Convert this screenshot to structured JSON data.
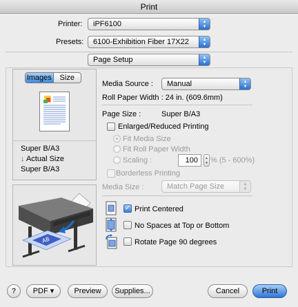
{
  "window": {
    "title": "Print"
  },
  "printer": {
    "label": "Printer:",
    "value": "iPF6100"
  },
  "presets": {
    "label": "Presets:",
    "value": "6100-Exhibition Fiber 17X22"
  },
  "section": {
    "value": "Page Setup"
  },
  "left_panel": {
    "tabs": [
      {
        "label": "Images"
      },
      {
        "label": "Size"
      }
    ],
    "size_text": [
      "Super B/A3",
      "Actual Size",
      "Super B/A3"
    ]
  },
  "media_source": {
    "label": "Media Source :",
    "value": "Manual"
  },
  "roll_paper_width": {
    "text": "Roll Paper Width : 24 in. (609.6mm)"
  },
  "page_size": {
    "label": "Page Size :",
    "value": "Super B/A3"
  },
  "enlarged": {
    "label": "Enlarged/Reduced Printing"
  },
  "fit_media": {
    "label": "Fit Media Size"
  },
  "fit_roll": {
    "label": "Fit Roll Paper Width"
  },
  "scaling": {
    "label": "Scaling :",
    "value": "100",
    "suffix": "% (5 - 600%)"
  },
  "borderless": {
    "label": "Borderless Printing"
  },
  "media_size": {
    "label": "Media Size :",
    "value": "Match Page Size"
  },
  "print_centered": {
    "label": "Print Centered",
    "checked": true
  },
  "no_spaces": {
    "label": "No Spaces at Top or Bottom",
    "checked": false
  },
  "rotate": {
    "label": "Rotate Page 90 degrees",
    "checked": false
  },
  "footer": {
    "help": "?",
    "pdf": "PDF ▾",
    "preview": "Preview",
    "supplies": "Supplies...",
    "cancel": "Cancel",
    "print": "Print"
  },
  "colors": {
    "accent": "#3a7fd6",
    "panel": "#e7e7e7"
  }
}
